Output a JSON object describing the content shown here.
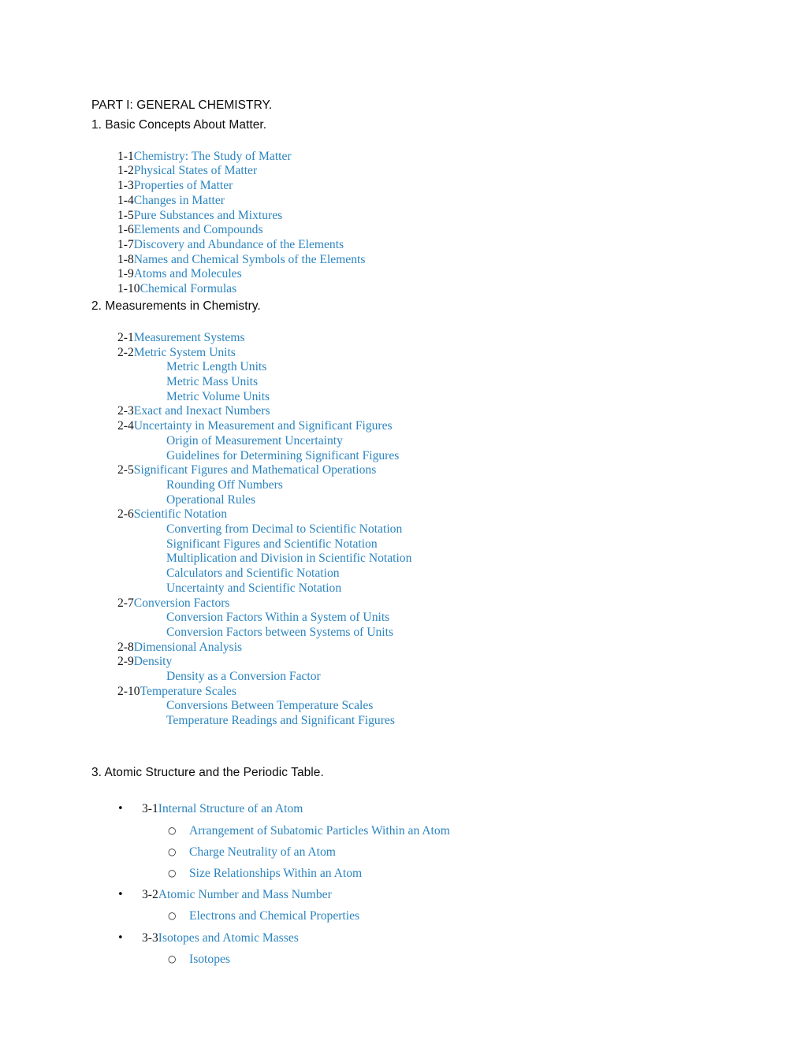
{
  "document": {
    "part_title": "PART I: GENERAL CHEMISTRY.",
    "accent_color": "#2b84bf",
    "heading_color": "#0d0d0d",
    "number_color": "#151515",
    "background_color": "#ffffff"
  },
  "chapters": [
    {
      "heading": "1. Basic Concepts About Matter.",
      "style": "plain",
      "entries": [
        {
          "level": 1,
          "number": "1-1",
          "title": "Chemistry: The Study of Matter"
        },
        {
          "level": 1,
          "number": "1-2",
          "title": "Physical States of Matter"
        },
        {
          "level": 1,
          "number": "1-3",
          "title": "Properties of Matter"
        },
        {
          "level": 1,
          "number": "1-4",
          "title": "Changes in Matter"
        },
        {
          "level": 1,
          "number": "1-5",
          "title": "Pure Substances and Mixtures"
        },
        {
          "level": 1,
          "number": "1-6",
          "title": "Elements and Compounds"
        },
        {
          "level": 1,
          "number": "1-7",
          "title": "Discovery and Abundance of the Elements"
        },
        {
          "level": 1,
          "number": "1-8",
          "title": "Names and Chemical Symbols of the Elements"
        },
        {
          "level": 1,
          "number": "1-9",
          "title": "Atoms and Molecules"
        },
        {
          "level": 1,
          "number": "1-10",
          "title": "Chemical Formulas"
        }
      ]
    },
    {
      "heading": "2. Measurements in Chemistry.",
      "style": "plain",
      "entries": [
        {
          "level": 1,
          "number": "2-1",
          "title": "Measurement Systems"
        },
        {
          "level": 1,
          "number": "2-2",
          "title": "Metric System Units"
        },
        {
          "level": 2,
          "number": "",
          "title": "Metric Length Units"
        },
        {
          "level": 2,
          "number": "",
          "title": "Metric Mass Units"
        },
        {
          "level": 2,
          "number": "",
          "title": "Metric Volume Units"
        },
        {
          "level": 1,
          "number": "2-3",
          "title": "Exact and Inexact Numbers"
        },
        {
          "level": 1,
          "number": "2-4",
          "title": "Uncertainty in Measurement and Significant Figures"
        },
        {
          "level": 2,
          "number": "",
          "title": "Origin of Measurement Uncertainty"
        },
        {
          "level": 2,
          "number": "",
          "title": "Guidelines for Determining Significant Figures"
        },
        {
          "level": 1,
          "number": "2-5",
          "title": "Significant Figures and Mathematical Operations"
        },
        {
          "level": 2,
          "number": "",
          "title": "Rounding Off Numbers"
        },
        {
          "level": 2,
          "number": "",
          "title": "Operational Rules"
        },
        {
          "level": 1,
          "number": "2-6",
          "title": "Scientific Notation"
        },
        {
          "level": 2,
          "number": "",
          "title": "Converting from Decimal to Scientific Notation"
        },
        {
          "level": 2,
          "number": "",
          "title": "Significant Figures and Scientific Notation"
        },
        {
          "level": 2,
          "number": "",
          "title": "Multiplication and Division in Scientific Notation"
        },
        {
          "level": 2,
          "number": "",
          "title": "Calculators and Scientific Notation"
        },
        {
          "level": 2,
          "number": "",
          "title": "Uncertainty and Scientific Notation"
        },
        {
          "level": 1,
          "number": "2-7",
          "title": "Conversion Factors"
        },
        {
          "level": 2,
          "number": "",
          "title": "Conversion Factors Within a System of Units"
        },
        {
          "level": 2,
          "number": "",
          "title": "Conversion Factors between Systems of Units"
        },
        {
          "level": 1,
          "number": "2-8",
          "title": "Dimensional Analysis"
        },
        {
          "level": 1,
          "number": "2-9",
          "title": "Density"
        },
        {
          "level": 2,
          "number": "",
          "title": "Density as a Conversion Factor"
        },
        {
          "level": 1,
          "number": "2-10",
          "title": "Temperature Scales"
        },
        {
          "level": 2,
          "number": "",
          "title": "Conversions Between Temperature Scales"
        },
        {
          "level": 2,
          "number": "",
          "title": "Temperature Readings and Significant Figures"
        }
      ]
    },
    {
      "heading": "3. Atomic Structure and the Periodic Table.",
      "style": "bulleted",
      "entries": [
        {
          "level": 1,
          "bullet": "•",
          "number": "3-1",
          "title": "Internal Structure of an Atom"
        },
        {
          "level": 2,
          "bullet": "○",
          "number": "",
          "title": "Arrangement of Subatomic Particles Within an Atom"
        },
        {
          "level": 2,
          "bullet": "○",
          "number": "",
          "title": "Charge Neutrality of an Atom"
        },
        {
          "level": 2,
          "bullet": "○",
          "number": "",
          "title": "Size Relationships Within an Atom"
        },
        {
          "level": 1,
          "bullet": "•",
          "number": "3-2",
          "title": "Atomic Number and Mass Number"
        },
        {
          "level": 2,
          "bullet": "○",
          "number": "",
          "title": "Electrons and Chemical Properties"
        },
        {
          "level": 1,
          "bullet": "•",
          "number": "3-3",
          "title": "Isotopes and Atomic Masses"
        },
        {
          "level": 2,
          "bullet": "○",
          "number": "",
          "title": "Isotopes"
        }
      ]
    }
  ]
}
